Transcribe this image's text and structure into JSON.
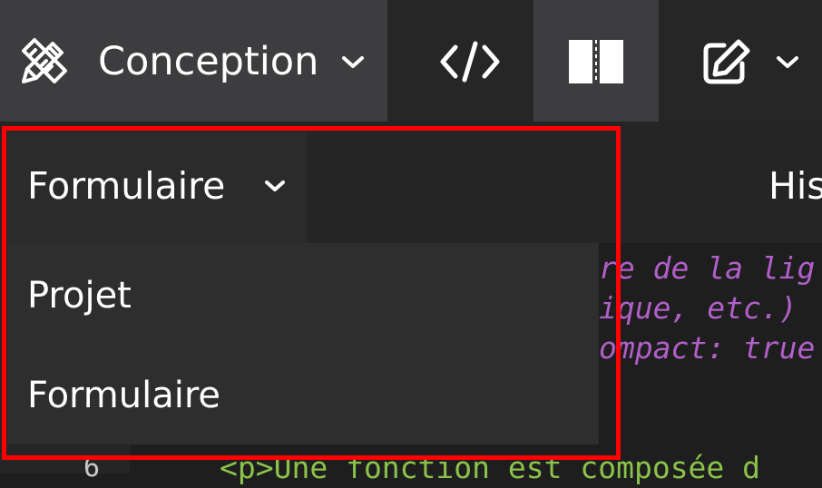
{
  "toolbar": {
    "mode_label": "Conception",
    "mode_icon": "pencil-ruler-icon",
    "code_view_icon": "code-icon",
    "split_view_icon": "split-view-icon",
    "edit_icon": "edit-icon"
  },
  "subbar": {
    "history_label": "His"
  },
  "editor": {
    "comment_lines": [
      "re de la lig",
      "ique, etc.)",
      "ompact: true"
    ],
    "visible_code": "<p>Une fonction est composée d",
    "line_number": "6"
  },
  "dropdown": {
    "selected_label": "Formulaire",
    "items": [
      {
        "label": "Projet"
      },
      {
        "label": "Formulaire"
      }
    ]
  },
  "colors": {
    "highlight": "#ff0000",
    "comment": "#b15fc9",
    "code_text": "#8bc34a",
    "toolbar_active": "#3d3d3f"
  }
}
